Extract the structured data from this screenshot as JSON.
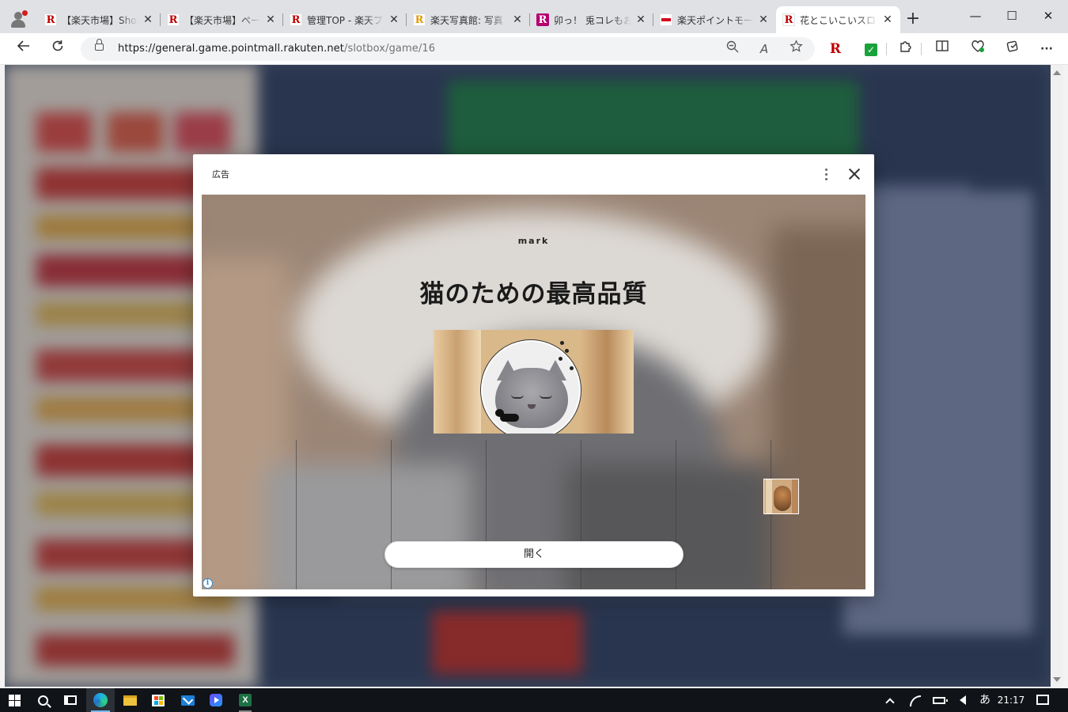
{
  "browser": {
    "tabs": [
      {
        "title": "【楽天市場】Shopping",
        "favicon": "rakuten-r-icon",
        "active": false
      },
      {
        "title": "【楽天市場】ページ",
        "favicon": "rakuten-r-icon",
        "active": false
      },
      {
        "title": "管理TOP - 楽天ブ",
        "favicon": "rakuten-r-icon",
        "active": false
      },
      {
        "title": "楽天写真館: 写真",
        "favicon": "rakuten-photo-icon",
        "active": false
      },
      {
        "title": "卯っ！ 兎コレもお気",
        "favicon": "rakuten-blog-icon",
        "active": false
      },
      {
        "title": "楽天ポイントモール",
        "favicon": "point-mall-icon",
        "active": false
      },
      {
        "title": "花とこいこいスロット",
        "favicon": "rakuten-r-icon",
        "active": true
      }
    ],
    "new_tab": "+",
    "window_controls": {
      "minimize": "—",
      "maximize": "☐",
      "close": "✕"
    },
    "url": {
      "host": "https://general.game.pointmall.rakuten.net",
      "path": "/slotbox/game/16"
    },
    "toolbar_icons": [
      "back-icon",
      "refresh-icon",
      "zoom-icon",
      "read-aloud-icon",
      "favorite-star-icon",
      "rakuten-extension-icon",
      "checkmark-extension-icon",
      "extensions-icon",
      "split-screen-icon",
      "performance-icon",
      "collections-icon",
      "more-icon"
    ],
    "read_aloud_glyph": "A",
    "rakuten_extension_glyph": "R",
    "checkmark_glyph": "✓",
    "more_glyph": "···"
  },
  "ad_modal": {
    "label": "広告",
    "brand": "mark",
    "headline": "猫のための最高品質",
    "cta": "開く",
    "info_glyph": "i",
    "colors": {
      "cta_bg": "#ffffff",
      "creative_bg": "#8c7a6a"
    }
  },
  "taskbar": {
    "apps": [
      "windows-start-icon",
      "search-icon",
      "task-view-icon",
      "edge-icon",
      "file-explorer-icon",
      "store-icon",
      "mail-icon",
      "media-player-icon",
      "excel-icon"
    ],
    "excel_glyph": "X",
    "ime": "あ",
    "time": "21:17"
  }
}
